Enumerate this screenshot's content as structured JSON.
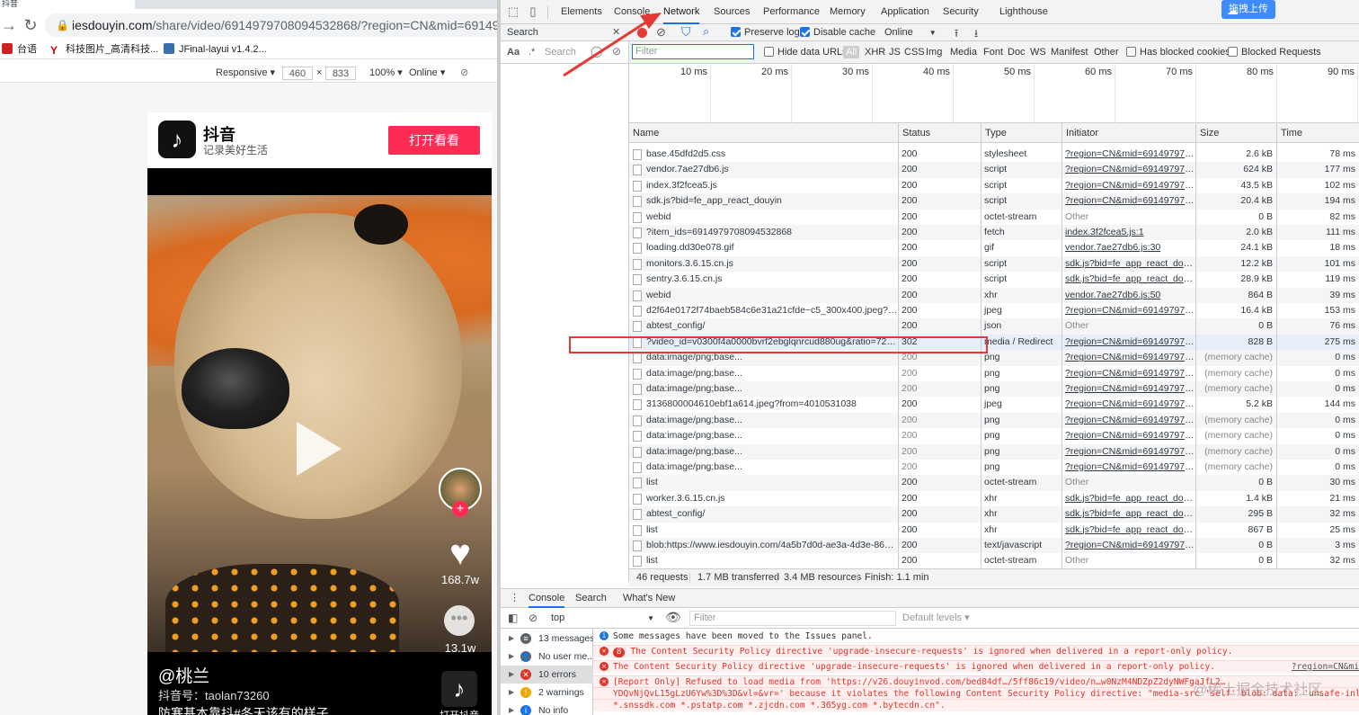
{
  "browser": {
    "tab_label": "抖音",
    "url_host": "iesdouyin.com",
    "url_path": "/share/video/6914979708094532868/?region=CN&mid=691497978386",
    "bookmarks": [
      "台语",
      "科技图片_高清科技...",
      "JFinal-layui v1.4.2..."
    ],
    "device_toolbar": {
      "mode": "Responsive ▾",
      "width": "460",
      "height": "833",
      "times": "×",
      "zoom": "100% ▾",
      "throttle": "Online ▾"
    }
  },
  "douyin": {
    "logo_glyph": "♪",
    "app_name": "抖音",
    "slogan": "记录美好生活",
    "open_button": "打开看看",
    "plus": "+",
    "like_count": "168.7w",
    "comment_count": "13.1w",
    "comment_glyph": "•••",
    "author": "@桃兰",
    "douyin_id": "抖音号：taolan73260",
    "caption": "防寒基本靠抖#冬天该有的样子",
    "open_app_label": "打开抖音"
  },
  "devtools": {
    "tabs": [
      "Elements",
      "Console",
      "Network",
      "Sources",
      "Performance",
      "Memory",
      "Application",
      "Security",
      "Lighthouse"
    ],
    "active_tab": "Network",
    "upload_button": "拖拽上传",
    "search_panel": {
      "title": "Search",
      "close": "✕",
      "aa": "Aa",
      "regex": ".*",
      "placeholder": "Search"
    },
    "net_toolbar": {
      "preserve_log": "Preserve log",
      "disable_cache": "Disable cache",
      "throttle": "Online"
    },
    "filter": {
      "placeholder": "Filter",
      "hide_data_urls": "Hide data URLs",
      "types": [
        "All",
        "XHR",
        "JS",
        "CSS",
        "Img",
        "Media",
        "Font",
        "Doc",
        "WS",
        "Manifest",
        "Other"
      ],
      "has_blocked_cookies": "Has blocked cookies",
      "blocked_requests": "Blocked Requests"
    },
    "timeline_ticks": [
      "10 ms",
      "20 ms",
      "30 ms",
      "40 ms",
      "50 ms",
      "60 ms",
      "70 ms",
      "80 ms",
      "90 ms"
    ],
    "columns": [
      "Name",
      "Status",
      "Type",
      "Initiator",
      "Size",
      "Time"
    ],
    "rows": [
      {
        "name": "base.45dfd2d5.css",
        "status": "200",
        "type": "stylesheet",
        "initiator": "?region=CN&mid=691497978...",
        "size": "2.6 kB",
        "time": "78 ms"
      },
      {
        "name": "vendor.7ae27db6.js",
        "status": "200",
        "type": "script",
        "initiator": "?region=CN&mid=691497978...",
        "size": "624 kB",
        "time": "177 ms"
      },
      {
        "name": "index.3f2fcea5.js",
        "status": "200",
        "type": "script",
        "initiator": "?region=CN&mid=691497978...",
        "size": "43.5 kB",
        "time": "102 ms"
      },
      {
        "name": "sdk.js?bid=fe_app_react_douyin",
        "status": "200",
        "type": "script",
        "initiator": "?region=CN&mid=691497978...",
        "size": "20.4 kB",
        "time": "194 ms"
      },
      {
        "name": "webid",
        "status": "200",
        "type": "octet-stream",
        "initiator": "Other",
        "size": "0 B",
        "time": "82 ms"
      },
      {
        "name": "?item_ids=6914979708094532868",
        "status": "200",
        "type": "fetch",
        "initiator": "index.3f2fcea5.js:1",
        "size": "2.0 kB",
        "time": "111 ms"
      },
      {
        "name": "loading.dd30e078.gif",
        "status": "200",
        "type": "gif",
        "initiator": "vendor.7ae27db6.js:30",
        "size": "24.1 kB",
        "time": "18 ms"
      },
      {
        "name": "monitors.3.6.15.cn.js",
        "status": "200",
        "type": "script",
        "initiator": "sdk.js?bid=fe_app_react_douyi...",
        "size": "12.2 kB",
        "time": "101 ms"
      },
      {
        "name": "sentry.3.6.15.cn.js",
        "status": "200",
        "type": "script",
        "initiator": "sdk.js?bid=fe_app_react_douyi...",
        "size": "28.9 kB",
        "time": "119 ms"
      },
      {
        "name": "webid",
        "status": "200",
        "type": "xhr",
        "initiator": "vendor.7ae27db6.js:50",
        "size": "864 B",
        "time": "39 ms"
      },
      {
        "name": "d2f64e0172f74baeb584c6e31a21cfde~c5_300x400.jpeg?from...",
        "status": "200",
        "type": "jpeg",
        "initiator": "?region=CN&mid=691497978...",
        "size": "16.4 kB",
        "time": "153 ms"
      },
      {
        "name": "abtest_config/",
        "status": "200",
        "type": "json",
        "initiator": "Other",
        "size": "0 B",
        "time": "76 ms"
      },
      {
        "name": "?video_id=v0300f4a0000bvrf2ebglqnrcud880ug&ratio=720p...",
        "status": "302",
        "type": "media / Redirect",
        "initiator": "?region=CN&mid=691497978...",
        "size": "828 B",
        "time": "275 ms"
      },
      {
        "name": "data:image/png;base...",
        "status": "200",
        "type": "png",
        "initiator": "?region=CN&mid=691497978...",
        "size": "(memory cache)",
        "time": "0 ms"
      },
      {
        "name": "data:image/png;base...",
        "status": "200",
        "type": "png",
        "initiator": "?region=CN&mid=691497978...",
        "size": "(memory cache)",
        "time": "0 ms"
      },
      {
        "name": "data:image/png;base...",
        "status": "200",
        "type": "png",
        "initiator": "?region=CN&mid=691497978...",
        "size": "(memory cache)",
        "time": "0 ms"
      },
      {
        "name": "3136800004610ebf1a614.jpeg?from=4010531038",
        "status": "200",
        "type": "jpeg",
        "initiator": "?region=CN&mid=691497978...",
        "size": "5.2 kB",
        "time": "144 ms"
      },
      {
        "name": "data:image/png;base...",
        "status": "200",
        "type": "png",
        "initiator": "?region=CN&mid=691497978...",
        "size": "(memory cache)",
        "time": "0 ms"
      },
      {
        "name": "data:image/png;base...",
        "status": "200",
        "type": "png",
        "initiator": "?region=CN&mid=691497978...",
        "size": "(memory cache)",
        "time": "0 ms"
      },
      {
        "name": "data:image/png;base...",
        "status": "200",
        "type": "png",
        "initiator": "?region=CN&mid=691497978...",
        "size": "(memory cache)",
        "time": "0 ms"
      },
      {
        "name": "data:image/png;base...",
        "status": "200",
        "type": "png",
        "initiator": "?region=CN&mid=691497978...",
        "size": "(memory cache)",
        "time": "0 ms"
      },
      {
        "name": "list",
        "status": "200",
        "type": "octet-stream",
        "initiator": "Other",
        "size": "0 B",
        "time": "30 ms"
      },
      {
        "name": "worker.3.6.15.cn.js",
        "status": "200",
        "type": "xhr",
        "initiator": "sdk.js?bid=fe_app_react_douyi...",
        "size": "1.4 kB",
        "time": "21 ms"
      },
      {
        "name": "abtest_config/",
        "status": "200",
        "type": "xhr",
        "initiator": "sdk.js?bid=fe_app_react_douyi...",
        "size": "295 B",
        "time": "32 ms"
      },
      {
        "name": "list",
        "status": "200",
        "type": "xhr",
        "initiator": "sdk.js?bid=fe_app_react_douyi...",
        "size": "867 B",
        "time": "25 ms"
      },
      {
        "name": "blob:https://www.iesdouyin.com/4a5b7d0d-ae3a-4d3e-86b5-...",
        "status": "200",
        "type": "text/javascript",
        "initiator": "?region=CN&mid=691497978...",
        "size": "0 B",
        "time": "3 ms"
      },
      {
        "name": "list",
        "status": "200",
        "type": "octet-stream",
        "initiator": "Other",
        "size": "0 B",
        "time": "32 ms"
      }
    ],
    "summary": [
      "46 requests",
      "1.7 MB transferred",
      "3.4 MB resources",
      "Finish: 1.1 min"
    ],
    "drawer_tabs": [
      "Console",
      "Search",
      "What's New"
    ],
    "console": {
      "context": "top",
      "filter_placeholder": "Filter",
      "levels": "Default levels ▾",
      "sidebar": [
        {
          "label": "13 messages",
          "color": "#5f6368"
        },
        {
          "label": "No user me...",
          "color": "#5f6368"
        },
        {
          "label": "10 errors",
          "color": "#e0342a"
        },
        {
          "label": "2 warnings",
          "color": "#f2a600"
        },
        {
          "label": "No info",
          "color": "#1a73e8"
        }
      ],
      "messages": [
        {
          "kind": "info",
          "text": "Some messages have been moved to the Issues panel."
        },
        {
          "kind": "err",
          "badge": "8",
          "text": "The Content Security Policy directive 'upgrade-insecure-requests' is ignored when delivered in a report-only policy."
        },
        {
          "kind": "err",
          "text": "The Content Security Policy directive 'upgrade-insecure-requests' is ignored when delivered in a report-only policy.",
          "source": "?region=CN&mi"
        },
        {
          "kind": "err",
          "text": "[Report Only] Refused to load media from 'https://v26.douyinvod.com/bed84df…/5ff86c19/video/n…w0NzM4NDZpZ2dyNWFgaJfL2…"
        },
        {
          "kind": "err",
          "text": "YDQvNjQvL15gLzU6Yw%3D%3D&vl=&vr=' because it violates the following Content Security Policy directive: \"media-src 'self' blob: data: 'unsafe-inline'"
        },
        {
          "kind": "err",
          "text": "*.snssdk.com *.pstatp.com *.zjcdn.com *.365yg.com *.bytecdn.cn\"."
        }
      ]
    },
    "watermark": "@稀土掘金技术社区"
  },
  "colors": {
    "accent": "#1a73e8",
    "douyin_red": "#fe2c55",
    "annotation_red": "#e53935",
    "error_red": "#e0342a"
  }
}
